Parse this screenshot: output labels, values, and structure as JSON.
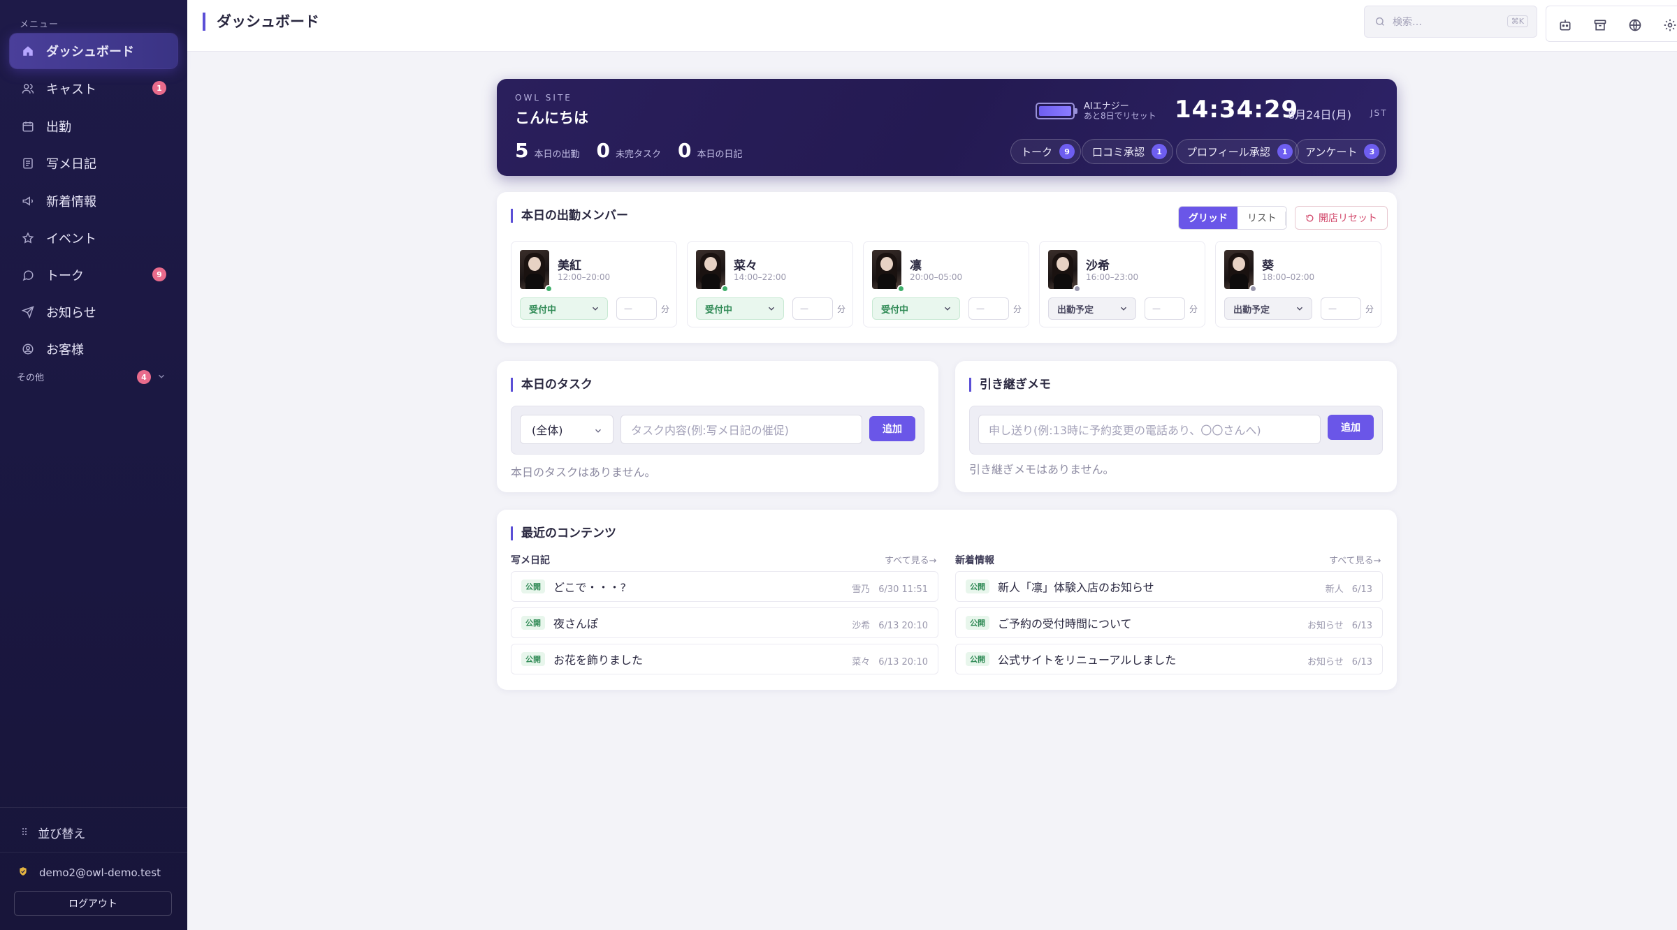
{
  "sidebar": {
    "caption": "メニュー",
    "items": [
      {
        "label": "ダッシュボード",
        "badge": ""
      },
      {
        "label": "キャスト",
        "badge": "1"
      },
      {
        "label": "出勤",
        "badge": ""
      },
      {
        "label": "写メ日記",
        "badge": ""
      },
      {
        "label": "新着情報",
        "badge": ""
      },
      {
        "label": "イベント",
        "badge": ""
      },
      {
        "label": "トーク",
        "badge": "9"
      },
      {
        "label": "お知らせ",
        "badge": ""
      },
      {
        "label": "お客様",
        "badge": ""
      }
    ],
    "other": {
      "label": "その他",
      "badge": "4"
    },
    "sort_label": "並び替え",
    "user_email": "demo2@owl-demo.test",
    "logout_label": "ログアウト"
  },
  "header": {
    "title": "ダッシュボード",
    "search_placeholder": "検索…",
    "search_shortcut": "⌘K"
  },
  "hero": {
    "site": "OWL SITE",
    "greeting": "こんにちは",
    "stats": [
      {
        "value": "5",
        "label": "本日の出勤"
      },
      {
        "value": "0",
        "label": "未完タスク"
      },
      {
        "value": "0",
        "label": "本日の日記"
      }
    ],
    "energy_label": "AIエナジー",
    "energy_sub": "あと8日でリセット",
    "energy_level": 1.0,
    "clock": "14:34:29",
    "date": "8月24日(月)",
    "timezone": "JST",
    "pills": [
      {
        "label": "トーク",
        "count": "9"
      },
      {
        "label": "口コミ承認",
        "count": "1"
      },
      {
        "label": "プロフィール承認",
        "count": "1"
      },
      {
        "label": "アンケート",
        "count": "3"
      }
    ]
  },
  "members": {
    "title": "本日の出勤メンバー",
    "view_grid": "グリッド",
    "view_list": "リスト",
    "reset_label": "開店リセット",
    "unit": "分",
    "minutes_placeholder": "—",
    "list": [
      {
        "name": "美紅",
        "time": "12:00–20:00",
        "status": "受付中",
        "state": "green"
      },
      {
        "name": "菜々",
        "time": "14:00–22:00",
        "status": "受付中",
        "state": "green"
      },
      {
        "name": "凛",
        "time": "20:00–05:00",
        "status": "受付中",
        "state": "green"
      },
      {
        "name": "沙希",
        "time": "16:00–23:00",
        "status": "出勤予定",
        "state": "gray"
      },
      {
        "name": "葵",
        "time": "18:00–02:00",
        "status": "出勤予定",
        "state": "gray"
      }
    ]
  },
  "tasks": {
    "title": "本日のタスク",
    "filter": "(全体)",
    "placeholder": "タスク内容(例:写メ日記の催促)",
    "add": "追加",
    "empty": "本日のタスクはありません。"
  },
  "memo": {
    "title": "引き継ぎメモ",
    "placeholder": "申し送り(例:13時に予約変更の電話あり、〇〇さんへ)",
    "add": "追加",
    "empty": "引き継ぎメモはありません。"
  },
  "recent": {
    "title": "最近のコンテンツ",
    "diary": {
      "head": "写メ日記",
      "see_all": "すべて見る→",
      "rows": [
        {
          "tag": "公開",
          "title": "どこで・・・?",
          "author": "雪乃",
          "date": "6/30 11:51"
        },
        {
          "tag": "公開",
          "title": "夜さんぽ",
          "author": "沙希",
          "date": "6/13 20:10"
        },
        {
          "tag": "公開",
          "title": "お花を飾りました",
          "author": "菜々",
          "date": "6/13 20:10"
        }
      ]
    },
    "news": {
      "head": "新着情報",
      "see_all": "すべて見る→",
      "rows": [
        {
          "tag": "公開",
          "title": "新人「凛」体験入店のお知らせ",
          "author": "新人",
          "date": "6/13"
        },
        {
          "tag": "公開",
          "title": "ご予約の受付時間について",
          "author": "お知らせ",
          "date": "6/13"
        },
        {
          "tag": "公開",
          "title": "公式サイトをリニューアルしました",
          "author": "お知らせ",
          "date": "6/13"
        }
      ]
    }
  },
  "colors": {
    "accent": "#6a56e8",
    "sidebar_bg": "#1e1a48",
    "badge": "#e96b8c",
    "online": "#3fae6a",
    "offline": "#9a98ad"
  }
}
